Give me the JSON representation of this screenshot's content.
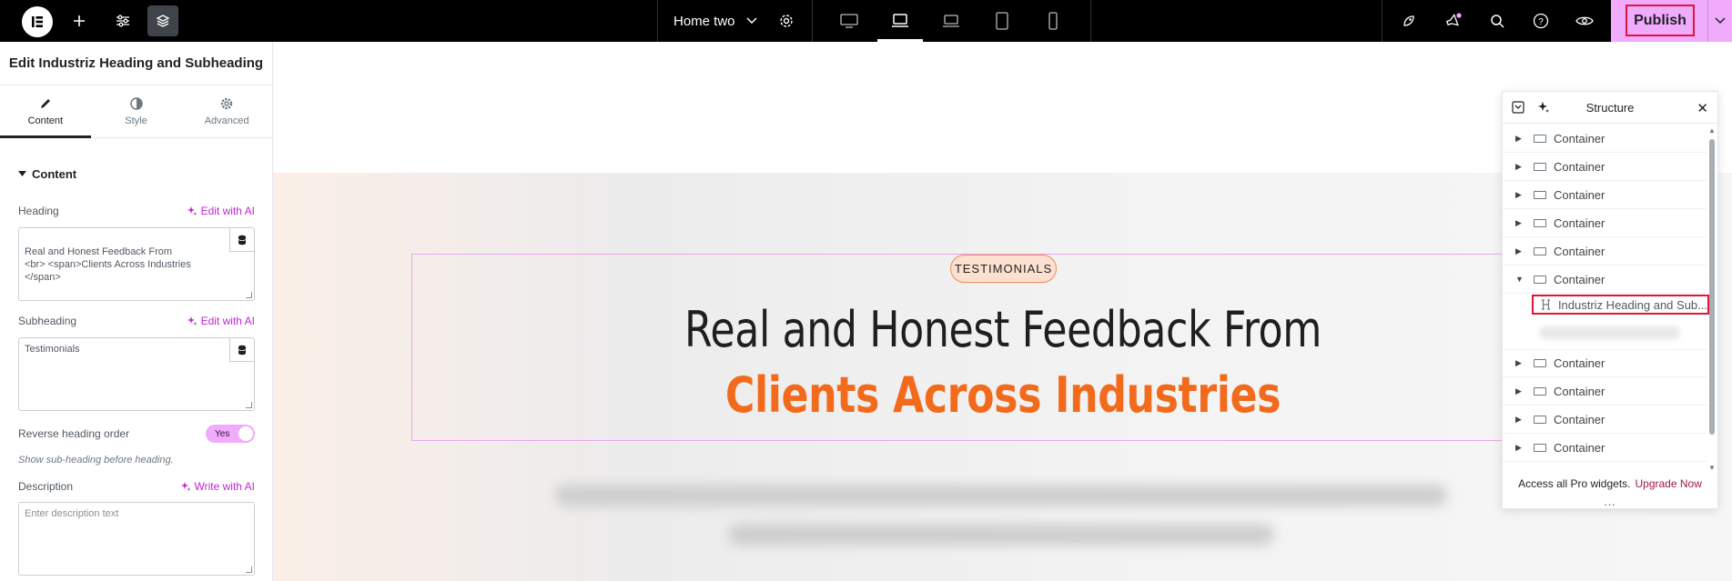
{
  "topbar": {
    "page_name": "Home two",
    "publish_label": "Publish",
    "devices": [
      "desktop",
      "laptop",
      "widescreen",
      "tablet",
      "mobile"
    ],
    "active_device": "laptop"
  },
  "panel": {
    "title": "Edit Industriz Heading and Subheading",
    "tabs": [
      {
        "label": "Content",
        "icon": "pencil-icon",
        "active": true
      },
      {
        "label": "Style",
        "icon": "half-circle-icon",
        "active": false
      },
      {
        "label": "Advanced",
        "icon": "gear-icon",
        "active": false
      }
    ],
    "section_title": "Content",
    "heading": {
      "label": "Heading",
      "ai_label": "Edit with AI",
      "value": "Real and Honest Feedback From\n<br> <span>Clients Across Industries </span>"
    },
    "subheading": {
      "label": "Subheading",
      "ai_label": "Edit with AI",
      "value": "Testimonials"
    },
    "reverse": {
      "label": "Reverse heading order",
      "toggle_label": "Yes",
      "hint": "Show sub-heading before heading."
    },
    "description": {
      "label": "Description",
      "ai_label": "Write with AI",
      "placeholder": "Enter description text"
    }
  },
  "canvas": {
    "badge": "TESTIMONIALS",
    "heading_line1": "Real and Honest Feedback From",
    "heading_line2": "Clients Across Industries",
    "accent_color": "#f26b1d"
  },
  "structure": {
    "title": "Structure",
    "rows": [
      {
        "label": "Container",
        "expanded": false
      },
      {
        "label": "Container",
        "expanded": false
      },
      {
        "label": "Container",
        "expanded": false
      },
      {
        "label": "Container",
        "expanded": false
      },
      {
        "label": "Container",
        "expanded": false
      },
      {
        "label": "Container",
        "expanded": true
      }
    ],
    "selected_item": "Industriz Heading and Sub...",
    "rows_after": [
      {
        "label": "Container",
        "expanded": false
      },
      {
        "label": "Container",
        "expanded": false
      },
      {
        "label": "Container",
        "expanded": false
      },
      {
        "label": "Container",
        "expanded": false
      }
    ],
    "footer_text": "Access all Pro widgets.",
    "footer_link": "Upgrade Now",
    "dots": "..."
  }
}
